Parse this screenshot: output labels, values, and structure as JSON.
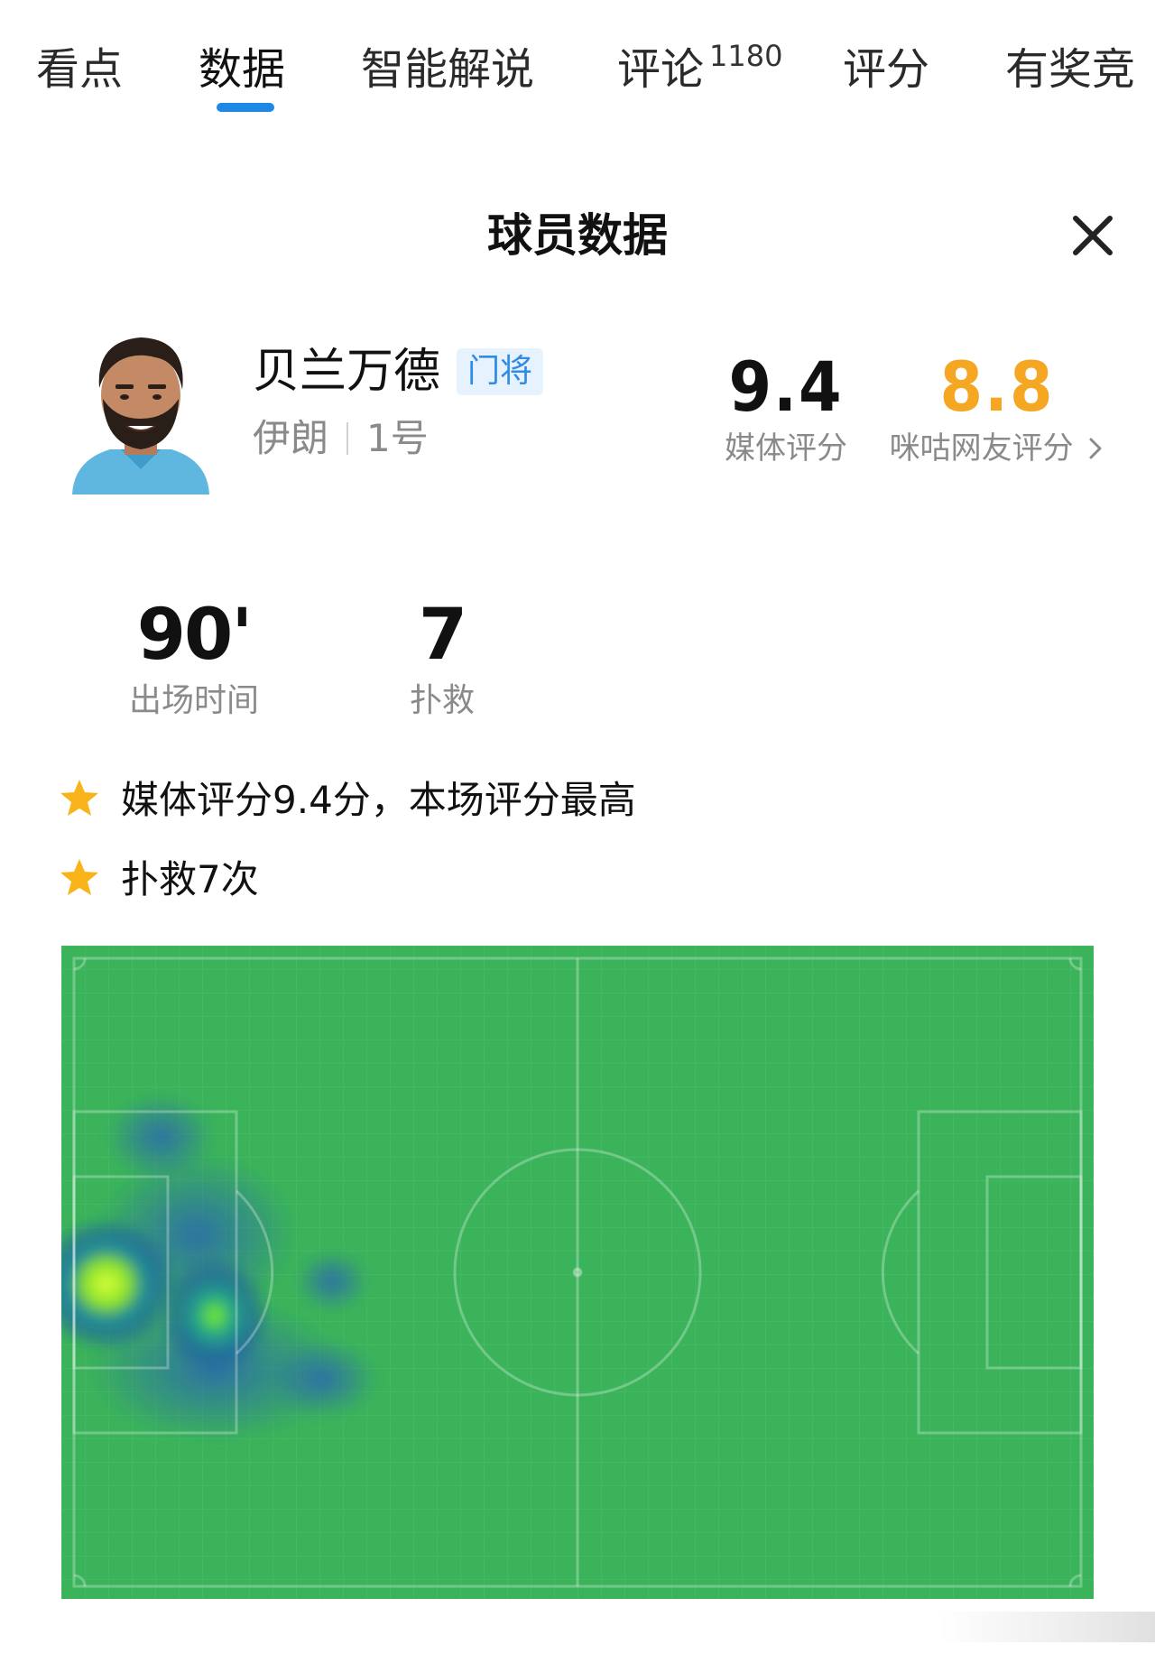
{
  "colors": {
    "accent": "#1e88e5",
    "fan_rating": "#f5a623",
    "badge_bg": "#e6f2fd",
    "badge_text": "#2f8be6",
    "pitch": "#3bb35a",
    "star": "#f9b41b"
  },
  "tabs": [
    {
      "label": "看点",
      "active": false
    },
    {
      "label": "数据",
      "active": true
    },
    {
      "label": "智能解说",
      "active": false
    },
    {
      "label": "评论",
      "count": "1180",
      "active": false
    },
    {
      "label": "评分",
      "active": false
    },
    {
      "label": "有奖竞",
      "active": false
    }
  ],
  "panel": {
    "title": "球员数据",
    "close_icon": "close-icon"
  },
  "player": {
    "name": "贝兰万德",
    "position": "门将",
    "nation": "伊朗",
    "number": "1号"
  },
  "ratings": {
    "media": {
      "value": "9.4",
      "label": "媒体评分"
    },
    "fans": {
      "value": "8.8",
      "label": "咪咕网友评分",
      "icon": "chevron-right-icon"
    }
  },
  "stats": [
    {
      "value": "90'",
      "label": "出场时间"
    },
    {
      "value": "7",
      "label": "扑救"
    }
  ],
  "highlights": [
    {
      "icon": "star-icon",
      "text": "媒体评分9.4分，本场评分最高"
    },
    {
      "icon": "star-icon",
      "text": "扑救7次"
    }
  ]
}
